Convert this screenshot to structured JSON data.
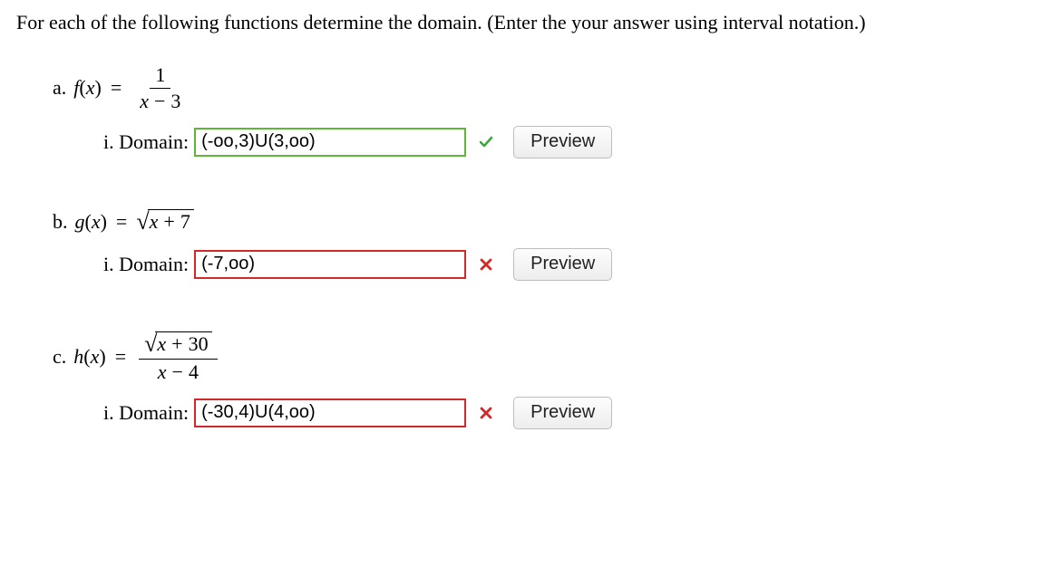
{
  "instructions": "For each of the following functions determine the domain. (Enter the your answer using interval notation.)",
  "problems": {
    "a": {
      "letter": "a.",
      "func_name": "f",
      "var": "x",
      "frac_num": "1",
      "frac_den_var": "x",
      "frac_den_const": "3",
      "sub_label": "i. Domain:",
      "input_value": "(-oo,3)U(3,oo)",
      "status": "correct",
      "preview": "Preview"
    },
    "b": {
      "letter": "b.",
      "func_name": "g",
      "var": "x",
      "sqrt_var": "x",
      "sqrt_const": "7",
      "sub_label": "i. Domain:",
      "input_value": "(-7,oo)",
      "status": "incorrect",
      "preview": "Preview"
    },
    "c": {
      "letter": "c.",
      "func_name": "h",
      "var": "x",
      "num_sqrt_var": "x",
      "num_sqrt_const": "30",
      "den_var": "x",
      "den_const": "4",
      "sub_label": "i. Domain:",
      "input_value": "(-30,4)U(4,oo)",
      "status": "incorrect",
      "preview": "Preview"
    }
  }
}
